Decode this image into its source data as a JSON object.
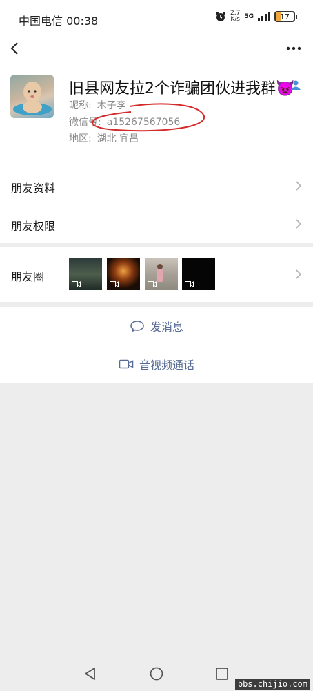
{
  "status_bar": {
    "carrier_time": "中国电信 00:38",
    "net_speed_value": "2.7",
    "net_speed_unit": "K/s",
    "network_type": "5G",
    "battery_level": "17",
    "battery_color": "#f3a53b"
  },
  "nav": {
    "back_icon": "chevron-left-icon",
    "more_icon": "more-dots-icon"
  },
  "profile": {
    "display_name": "旧县网友拉2个诈骗团伙进我群👿",
    "nickname_label": "昵称:",
    "nickname_value": "木子李",
    "wechat_id_label": "微信号:",
    "wechat_id_value": "a15267567056",
    "region_label": "地区:",
    "region_value": "湖北  宜昌"
  },
  "menu": {
    "friend_info": "朋友资料",
    "friend_permissions": "朋友权限",
    "moments": "朋友圈"
  },
  "actions": {
    "send_message": "发消息",
    "video_call": "音视频通话",
    "link_color": "#576b95"
  },
  "watermark": "bbs.chijio.com"
}
